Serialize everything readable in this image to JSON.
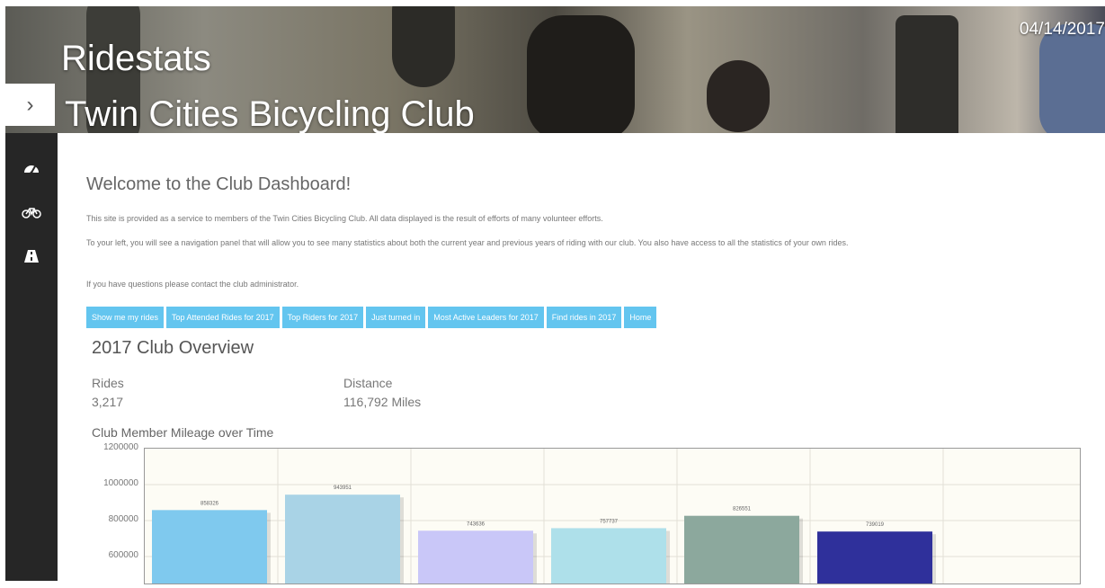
{
  "header": {
    "title": "Ridestats",
    "subtitle": "Twin Cities Bicycling Club",
    "date": "04/14/2017",
    "toggle_icon": "chevron-right-icon"
  },
  "sidebar": {
    "items": [
      {
        "icon": "dashboard-icon"
      },
      {
        "icon": "bicycle-icon"
      },
      {
        "icon": "road-icon"
      }
    ]
  },
  "main": {
    "welcome": "Welcome to the Club Dashboard!",
    "paragraph1": "This site is provided as a service to members of the Twin Cities Bicycling Club. All data displayed is the result of efforts of many volunteer efforts.",
    "paragraph2": "To your left, you will see a navigation panel that will allow you to see many statistics about both the current year and previous years of riding with our club. You also have access to all the statistics of your own rides.",
    "paragraph3": "If you have questions please contact the club administrator.",
    "buttons": [
      "Show me my rides",
      "Top Attended Rides for 2017",
      "Top Riders for 2017",
      "Just turned in",
      "Most Active Leaders for 2017",
      "Find rides in 2017",
      "Home"
    ],
    "overview_title": "2017 Club Overview",
    "stats": {
      "rides_label": "Rides",
      "rides_value": "3,217",
      "distance_label": "Distance",
      "distance_value": "116,792 Miles"
    },
    "chart_title": "Club Member Mileage over Time"
  },
  "chart_data": {
    "type": "bar",
    "title": "Club Member Mileage over Time",
    "values": [
      858326,
      943951,
      743636,
      757737,
      826551,
      739019
    ],
    "colors": [
      "#7fc9ee",
      "#a9d3e6",
      "#c9c7f8",
      "#aee0ea",
      "#8ca89d",
      "#2f309b"
    ],
    "y_ticks": [
      "1200000",
      "1000000",
      "800000",
      "600000"
    ],
    "ylim": [
      0,
      1200000
    ],
    "grid": true
  }
}
